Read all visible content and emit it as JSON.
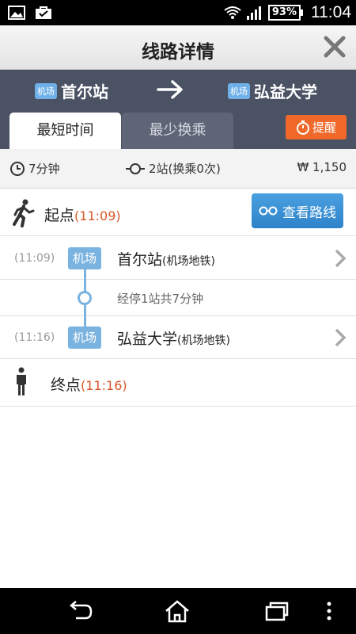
{
  "status_bar": {
    "battery": "93%",
    "time": "11:04"
  },
  "header": {
    "title": "线路详情"
  },
  "route": {
    "from": {
      "tag": "机场",
      "name": "首尔站"
    },
    "to": {
      "tag": "机场",
      "name": "弘益大学"
    }
  },
  "tabs": [
    {
      "label": "最短时间",
      "active": true
    },
    {
      "label": "最少换乘",
      "active": false
    }
  ],
  "remind_label": "提醒",
  "summary": {
    "time": "7分钟",
    "stops": "2站(换乘0次)",
    "fare": "₩ 1,150"
  },
  "start": {
    "label": "起点",
    "time": "(11:09)",
    "button": "查看路线"
  },
  "stations": [
    {
      "time": "(11:09)",
      "line": "机场",
      "name": "首尔站",
      "detail": "(机场地铁)"
    },
    {
      "time": "(11:16)",
      "line": "机场",
      "name": "弘益大学",
      "detail": "(机场地铁)"
    }
  ],
  "via": "经停1站共7分钟",
  "end": {
    "label": "终点",
    "time": "(11:16)"
  },
  "colors": {
    "header_bg": "#4a5264",
    "accent_blue": "#2f83c9",
    "remind_orange": "#f0692a",
    "time_orange": "#d9582a",
    "line_blue": "#7bb3e0"
  }
}
